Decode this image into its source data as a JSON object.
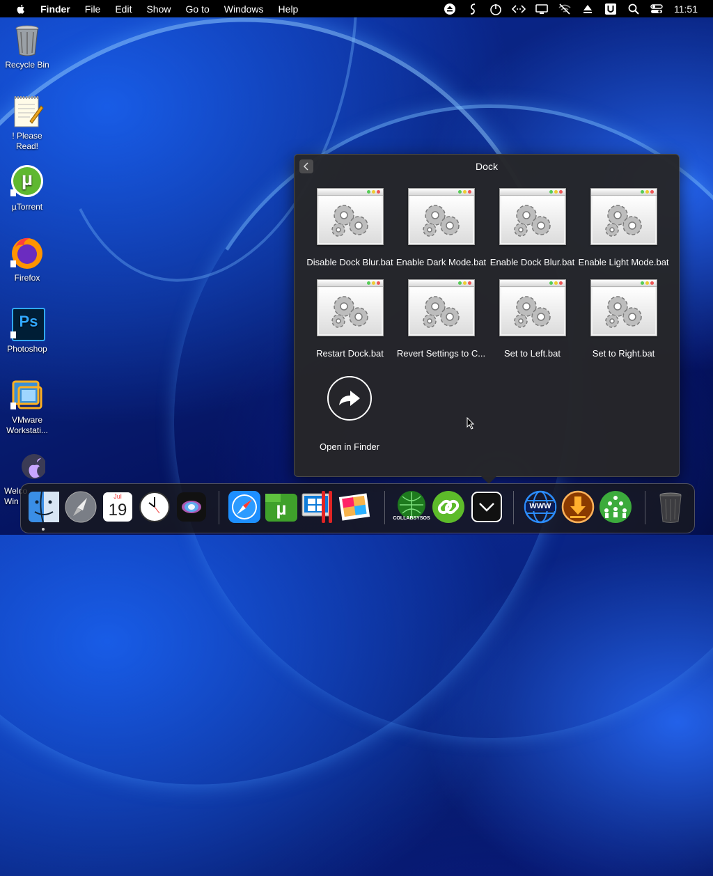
{
  "menubar": {
    "app_name": "Finder",
    "items": [
      "File",
      "Edit",
      "Show",
      "Go to",
      "Windows",
      "Help"
    ],
    "status_icons": [
      "eject-icon",
      "script-s-icon",
      "power-timer-icon",
      "code-arrows-icon",
      "display-icon",
      "wifi-off-icon",
      "upload-triangle-icon",
      "u-box-icon",
      "search-icon",
      "control-center-icon"
    ],
    "clock": "11:51"
  },
  "desktop": {
    "icons": [
      {
        "label": "Recycle Bin",
        "icon": "trash-icon"
      },
      {
        "label": "! Please Read!",
        "icon": "notepad-icon"
      },
      {
        "label": "µTorrent",
        "icon": "utorrent-icon"
      },
      {
        "label": "Firefox",
        "icon": "firefox-icon"
      },
      {
        "label": "Photoshop",
        "icon": "photoshop-icon"
      },
      {
        "label": "VMware Workstati...",
        "icon": "vmware-icon"
      },
      {
        "label": "Welco Win",
        "icon": "apple-welcome-icon"
      }
    ],
    "ps_text": "Ps",
    "ut_text": "µ"
  },
  "stack": {
    "title": "Dock",
    "files": [
      "Disable Dock Blur.bat",
      "Enable Dark Mode.bat",
      "Enable Dock Blur.bat",
      "Enable Light Mode.bat",
      "Restart Dock.bat",
      "Revert Settings to C...",
      "Set to Left.bat",
      "Set to Right.bat"
    ],
    "open_in_finder": "Open in Finder"
  },
  "dock": {
    "calendar_month": "Jul",
    "calendar_day": "19",
    "collabsysos_text": "COLLABSYSOS",
    "www_text": "WWW",
    "items": [
      "finder-icon",
      "launchpad-icon",
      "calendar-icon",
      "clock-icon",
      "siri-icon",
      "safari-icon",
      "utorrent-icon",
      "windows-bootcamp-icon",
      "photos-icon",
      "collabsysos-icon",
      "link-icon",
      "downloads-stack-icon",
      "www-globe-icon",
      "download-icon",
      "network-people-icon",
      "trash-icon"
    ]
  },
  "colors": {
    "menubar_bg": "#000000",
    "stack_bg": "#262628",
    "accent_blue": "#1a73e8"
  }
}
